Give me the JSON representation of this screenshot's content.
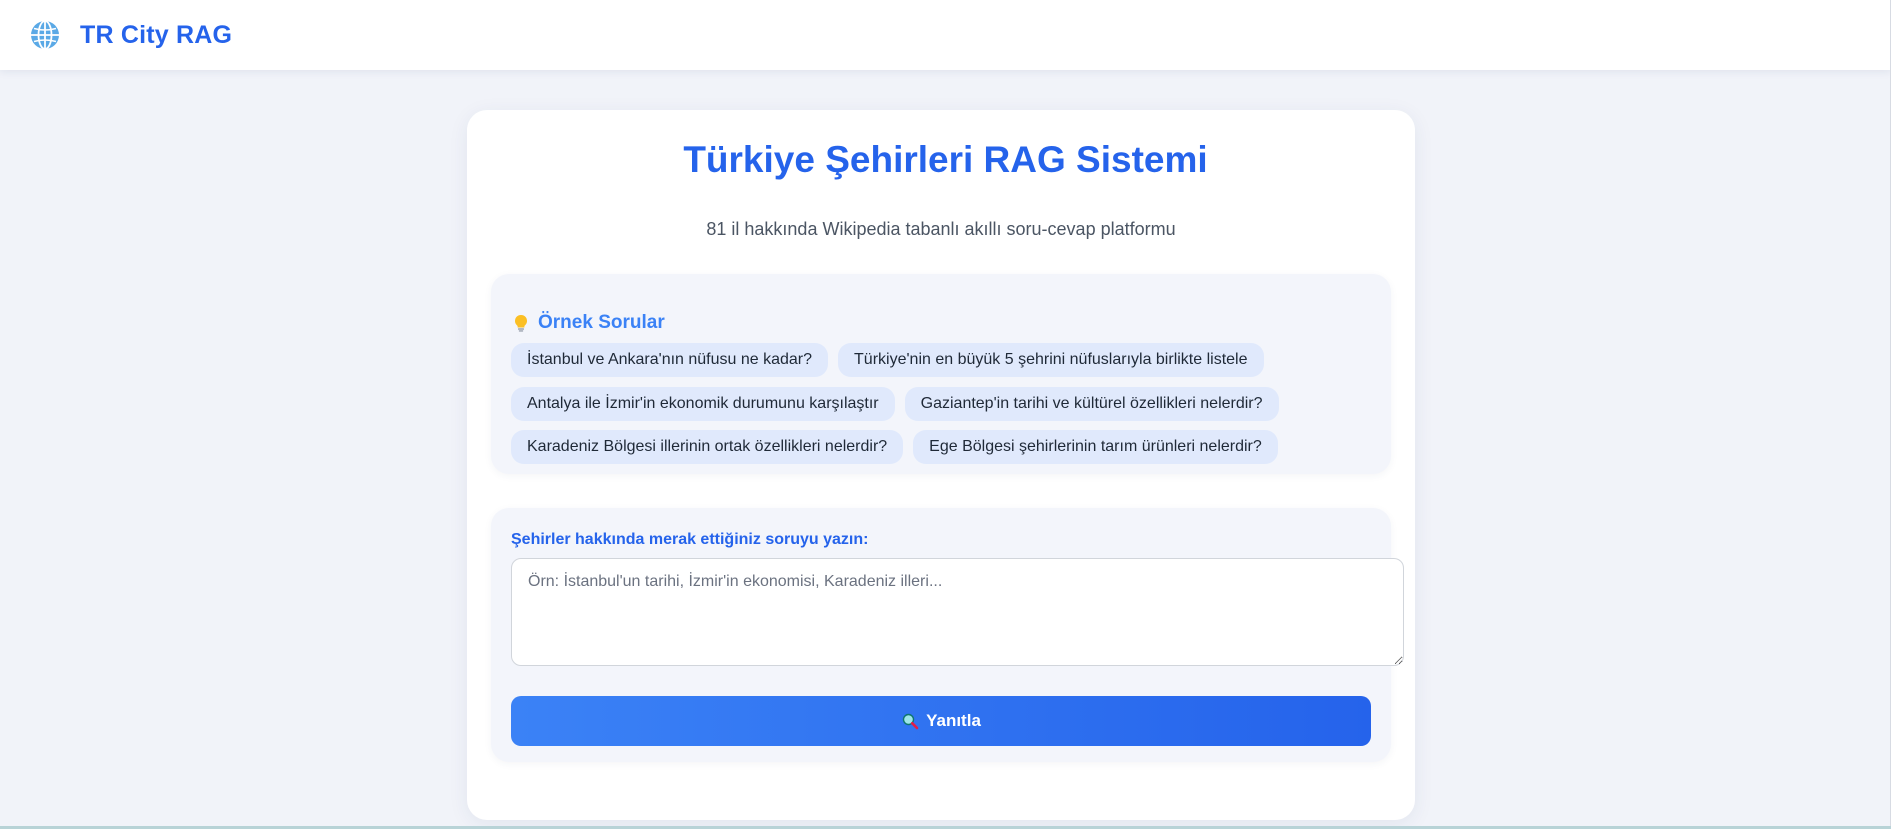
{
  "app": {
    "brand": "TR City RAG",
    "logo_icon": "globe-icon",
    "accent_color": "#2563eb"
  },
  "hero": {
    "title": "Türkiye Şehirleri RAG Sistemi",
    "subtitle": "81 il hakkında Wikipedia tabanlı akıllı soru-cevap platformu"
  },
  "examples": {
    "icon": "lightbulb-icon",
    "title": "Örnek Sorular",
    "rows": [
      [
        "İstanbul ve Ankara'nın nüfusu ne kadar?",
        "Türkiye'nin en büyük 5 şehrini nüfuslarıyla birlikte listele"
      ],
      [
        "Antalya ile İzmir'in ekonomik durumunu karşılaştır",
        "Gaziantep'in tarihi ve kültürel özellikleri nelerdir?"
      ],
      [
        "Karadeniz Bölgesi illerinin ortak özellikleri nelerdir?",
        "Ege Bölgesi şehirlerinin tarım ürünleri nelerdir?"
      ]
    ]
  },
  "ask": {
    "label": "Şehirler hakkında merak ettiğiniz soruyu yazın:",
    "value": "",
    "placeholder": "Örn: İstanbul'un tarihi, İzmir'in ekonomisi, Karadeniz illeri...",
    "button_icon": "magnifier-icon",
    "button_label": "Yanıtla"
  }
}
